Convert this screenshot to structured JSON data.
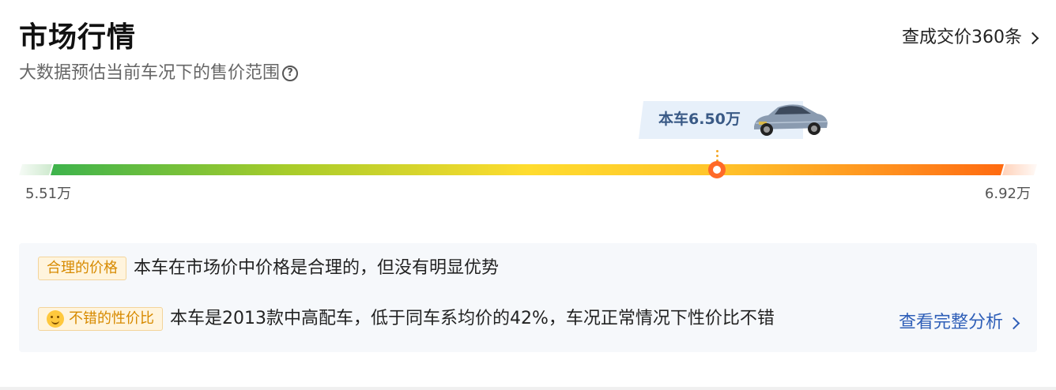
{
  "header": {
    "title": "市场行情",
    "subtitle": "大数据预估当前车况下的售价范围",
    "help_icon_glyph": "?",
    "deals_link": "查成交价360条"
  },
  "price_bar": {
    "marker_label": "本车6.50万",
    "min_label": "5.51万",
    "max_label": "6.92万",
    "min_value": 5.51,
    "max_value": 6.92,
    "current_value": 6.5
  },
  "analysis": {
    "row1": {
      "tag": "合理的价格",
      "text": "本车在市场价中价格是合理的，但没有明显优势"
    },
    "row2": {
      "tag_icon": "smile-emoji-icon",
      "tag": "不错的性价比",
      "text": "本车是2013款中高配车，低于同车系均价的42%，车况正常情况下性价比不错"
    },
    "link": "查看完整分析"
  },
  "colors": {
    "accent_link": "#2f5fb8",
    "knob": "#ff6a28",
    "tag_text": "#d78a00",
    "marker_text": "#3a5a86"
  }
}
